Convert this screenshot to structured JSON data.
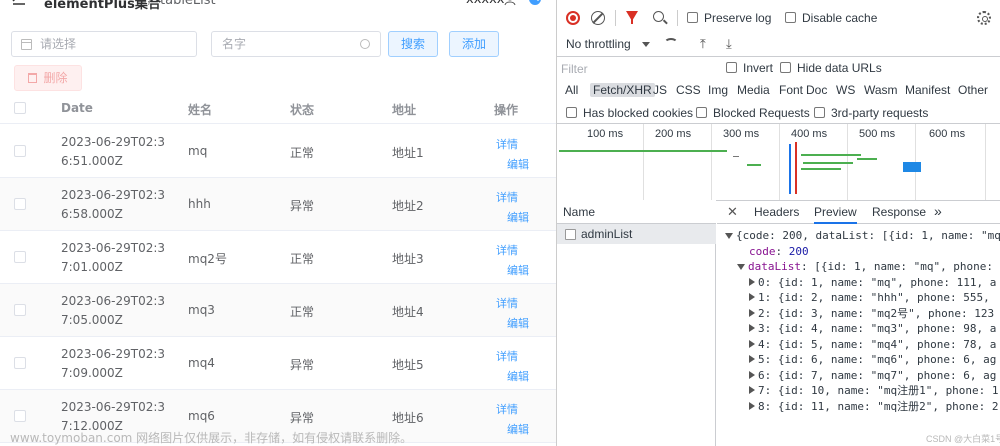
{
  "header": {
    "title": "elementPlus集合",
    "sep": "/",
    "page": "tableList",
    "user": "xxxxx"
  },
  "filters": {
    "select_placeholder": "请选择",
    "name_placeholder": "名字",
    "search_label": "搜索",
    "add_label": "添加",
    "delete_label": "删除"
  },
  "table": {
    "headers": {
      "date": "Date",
      "name": "姓名",
      "status": "状态",
      "address": "地址",
      "action": "操作"
    },
    "detail_label": "详情",
    "edit_label": "编辑",
    "rows": [
      {
        "date": "2023-06-29T02:36:51.000Z",
        "name": "mq",
        "status": "正常",
        "address": "地址1"
      },
      {
        "date": "2023-06-29T02:36:58.000Z",
        "name": "hhh",
        "status": "异常",
        "address": "地址2"
      },
      {
        "date": "2023-06-29T02:37:01.000Z",
        "name": "mq2号",
        "status": "正常",
        "address": "地址3"
      },
      {
        "date": "2023-06-29T02:37:05.000Z",
        "name": "mq3",
        "status": "正常",
        "address": "地址4"
      },
      {
        "date": "2023-06-29T02:37:09.000Z",
        "name": "mq4",
        "status": "异常",
        "address": "地址5"
      },
      {
        "date": "2023-06-29T02:37:12.000Z",
        "name": "mq6",
        "status": "异常",
        "address": "地址6"
      }
    ]
  },
  "devtools": {
    "preserve_log": "Preserve log",
    "disable_cache": "Disable cache",
    "throttling": "No throttling",
    "filter_placeholder": "Filter",
    "invert": "Invert",
    "hide_data_urls": "Hide data URLs",
    "types": [
      "All",
      "Fetch/XHR",
      "JS",
      "CSS",
      "Img",
      "Media",
      "Font",
      "Doc",
      "WS",
      "Wasm",
      "Manifest",
      "Other"
    ],
    "blocked_cookies": "Has blocked cookies",
    "blocked_requests": "Blocked Requests",
    "third_party": "3rd-party requests",
    "ticks": [
      "100 ms",
      "200 ms",
      "300 ms",
      "400 ms",
      "500 ms",
      "600 ms"
    ],
    "name_header": "Name",
    "request_name": "adminList",
    "tabs": [
      "Headers",
      "Preview",
      "Response"
    ],
    "more_tabs": "»",
    "preview": {
      "line0": "{code: 200, dataList: [{id: 1, name: \"mq",
      "code_key": "code",
      "code_val": "200",
      "list_key": "dataList",
      "list_rest": "[{id: 1, name: \"mq\", phone:",
      "items": [
        "0: {id: 1, name: \"mq\", phone: 111, a",
        "1: {id: 2, name: \"hhh\", phone: 555,",
        "2: {id: 3, name: \"mq2号\", phone: 123",
        "3: {id: 4, name: \"mq3\", phone: 98, a",
        "4: {id: 5, name: \"mq4\", phone: 78, a",
        "5: {id: 6, name: \"mq6\", phone: 6, ag",
        "6: {id: 7, name: \"mq7\", phone: 6, ag",
        "7: {id: 10, name: \"mq注册1\", phone: 1",
        "8: {id: 11, name: \"mq注册2\", phone: 2"
      ]
    }
  },
  "watermark": "www.toymoban.com 网络图片仅供展示，非存储，如有侵权请联系删除。",
  "watermark2": "CSDN @大白菜1号"
}
